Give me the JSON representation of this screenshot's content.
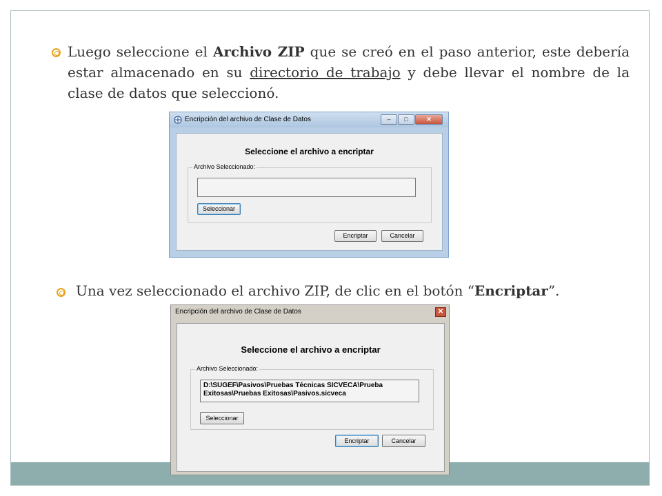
{
  "slide": {
    "bullet1": {
      "t1": "Luego seleccione el ",
      "b1": "Archivo ZIP",
      "t2": " que se creó en el paso anterior, este debería estar almacenado en su ",
      "u1": "directorio de trabajo",
      "t3": " y debe llevar el nombre de la clase de datos que seleccionó."
    },
    "bullet2": {
      "t1": "Una vez seleccionado el archivo ZIP, de clic en el botón “",
      "b1": "Encriptar",
      "t2": "”."
    }
  },
  "dialog1": {
    "title": "Encripción del archivo de Clase de Datos",
    "minimize": "‒",
    "maximize": "□",
    "close": "✕",
    "heading": "Seleccione el archivo a encriptar",
    "group_label": "Archivo Seleccionado:",
    "file_value": "",
    "select_button": "Seleccionar",
    "encrypt_button": "Encriptar",
    "cancel_button": "Cancelar"
  },
  "dialog2": {
    "title": "Encripción del archivo de Clase de Datos",
    "close": "✕",
    "heading": "Seleccione el archivo a encriptar",
    "group_label": "Archivo Seleccionado:",
    "file_value": "D:\\SUGEF\\Pasivos\\Pruebas Técnicas SICVECA\\Prueba Exitosas\\Pruebas Exitosas\\Pasivos.sicveca",
    "select_button": "Seleccionar",
    "encrypt_button": "Encriptar",
    "cancel_button": "Cancelar"
  },
  "colors": {
    "bullet": "#e9a21a",
    "footer_band": "#8eadad",
    "frame_border": "#a9bcbc"
  }
}
